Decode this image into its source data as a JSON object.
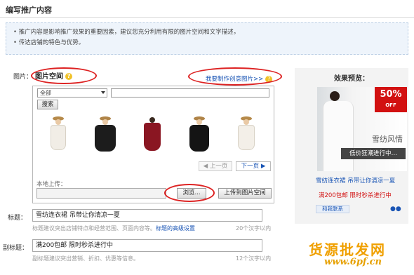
{
  "page": {
    "title": "编写推广内容"
  },
  "tips": [
    "推广内容是影响推广效果的重要因素，建议您充分利用有限的图片空间和文字描述，",
    "传达店铺的特色与优势。"
  ],
  "image_section": {
    "label": "图片：",
    "tab_label": "图片空间",
    "help_icon": "question-icon",
    "make_link": "我要制作创意图片>>",
    "category_select": "全部",
    "search_button": "搜索",
    "prev_page": "◀ 上一页",
    "next_page": "下一页 ▶",
    "local_upload_label": "本地上传：",
    "browse_button": "浏览...",
    "upload_button": "上传到图片空间"
  },
  "title_field": {
    "label": "标题：",
    "value": "雪纺连衣裙 吊带让你清凉一夏",
    "hint": "标题建议突出店铺特点和经营范围、页面内容等。",
    "hint_link": "标题的高级设置",
    "counter": "20个汉字以内"
  },
  "subtitle_field": {
    "label": "副标题：",
    "value": "满200包邮 限时秒杀进行中",
    "hint": "副标题建议突出营销、折扣、优惠等信息。",
    "counter": "12个汉字以内"
  },
  "preview": {
    "title": "效果预览：",
    "badge_main": "50%",
    "badge_sub": "OFF",
    "ad_text": "雪纺风情",
    "ad_bar": "低价狂潮进行中…",
    "ad_title": "雪纺连衣裙 吊带让你清凉一夏",
    "ad_subtitle": "满200包邮  限时秒杀进行中",
    "contact": "和我联系"
  },
  "watermark": {
    "text": "货源批发网",
    "url": "www.6pf.cn"
  },
  "colors": {
    "link": "#1a55b5",
    "accent_red": "#d21111",
    "annotation": "#dd2222"
  }
}
